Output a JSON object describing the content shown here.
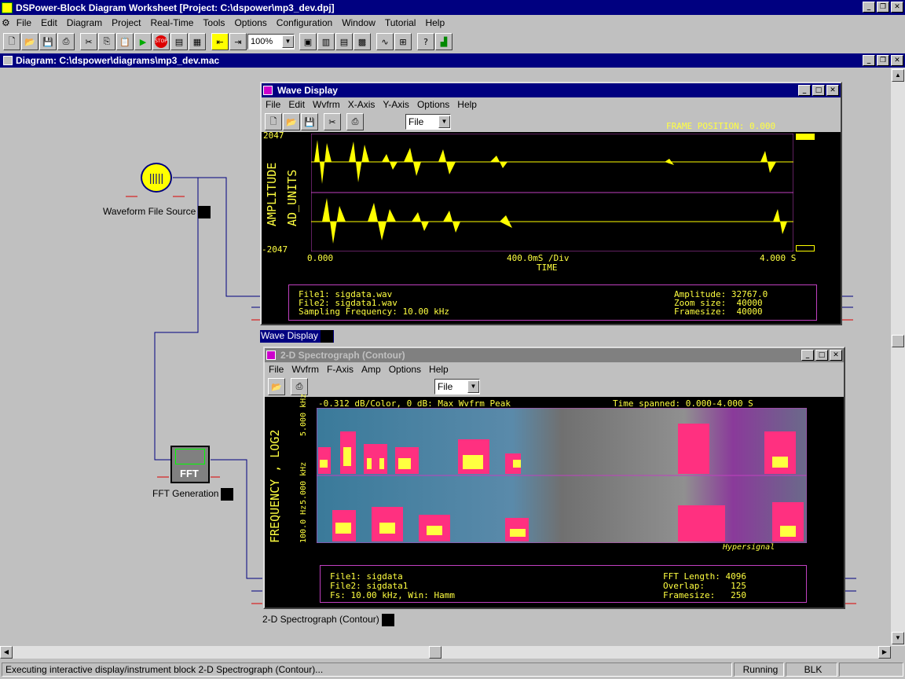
{
  "app": {
    "title": "DSPower-Block Diagram Worksheet [Project: C:\\dspower\\mp3_dev.dpj]"
  },
  "menu": [
    "File",
    "Edit",
    "Diagram",
    "Project",
    "Real-Time",
    "Tools",
    "Options",
    "Configuration",
    "Window",
    "Tutorial",
    "Help"
  ],
  "toolbar": {
    "zoom": "100%"
  },
  "diagram": {
    "title": "Diagram: C:\\dspower\\diagrams\\mp3_dev.mac"
  },
  "blocks": {
    "waveform_source": "Waveform File Source",
    "fft": "FFT Generation",
    "fft_text": "FFT",
    "wave_display": "Wave Display",
    "spectrograph": "2-D Spectrograph (Contour)"
  },
  "wave_window": {
    "title": "Wave Display",
    "menu": [
      "File",
      "Edit",
      "Wvfrm",
      "X-Axis",
      "Y-Axis",
      "Options",
      "Help"
    ],
    "select": "File",
    "frame_position": "FRAME POSITION: 0.000",
    "ymax": "2047",
    "ymin": "-2047",
    "ylabel1": "AMPLITUDE",
    "ylabel2": "AD_UNITS",
    "x_start": "0.000",
    "x_div": "400.0mS /Div",
    "x_end": "4.000 S",
    "xlabel": "TIME",
    "info": {
      "file1": "File1: sigdata.wav",
      "file2": "File2: sigdata1.wav",
      "fs": "Sampling Frequency: 10.00 kHz",
      "amp": "Amplitude: 32767.0",
      "zoom": "Zoom size:  40000",
      "frame": "Framesize:  40000"
    }
  },
  "spec_window": {
    "title": "2-D Spectrograph (Contour)",
    "menu": [
      "File",
      "Wvfrm",
      "F-Axis",
      "Amp",
      "Options",
      "Help"
    ],
    "select": "File",
    "header_left": "-0.312 dB/Color, 0 dB: Max Wvfrm Peak",
    "header_right": "Time spanned: 0.000-4.000 S",
    "ylabel": "FREQUENCY , LOG2",
    "tick_top1": "5.000 kHz",
    "tick_bot1": "5.000 kHz",
    "tick_bot2": "100.0 Hz",
    "watermark": "Hypersignal",
    "info": {
      "file1": "File1: sigdata",
      "file2": "File2: sigdata1",
      "fs": "Fs: 10.00 kHz, Win: Hamm",
      "fftlen": "FFT Length: 4096",
      "overlap": "Overlap:     125",
      "frame": "Framesize:   250"
    }
  },
  "status": {
    "message": "Executing interactive display/instrument block 2-D Spectrograph (Contour)...",
    "state": "Running",
    "mode": "BLK"
  }
}
